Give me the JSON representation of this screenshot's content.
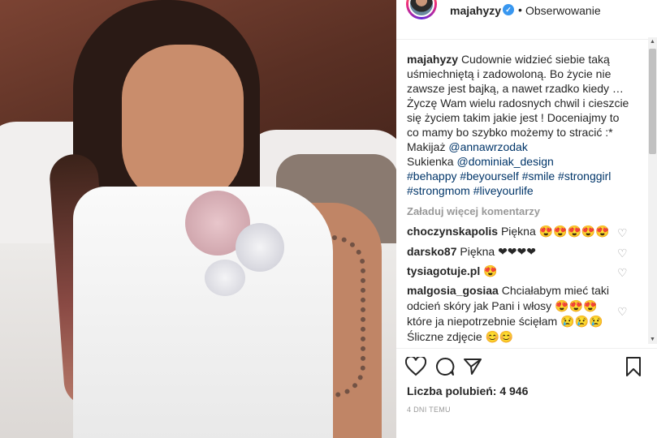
{
  "post": {
    "username": "majahyzy",
    "verified_mark": "✓",
    "separator": "•",
    "follow_label": "Obserwowanie"
  },
  "caption": {
    "username": "majahyzy",
    "text": "Cudownie widzieć siebie taką uśmiechniętą i zadowoloną. Bo życie nie zawsze jest bajką, a nawet rzadko kiedy … Życzę Wam wielu radosnych chwil i cieszcie się życiem takim jakie jest ! Doceniajmy to co mamy bo szybko możemy to stracić :*",
    "makeup_label": "Makijaż",
    "makeup_tag": "@annawrzodak",
    "dress_label": "Sukienka",
    "dress_tag": "@dominiak_design",
    "hashtags": [
      "#behappy",
      "#beyourself",
      "#smile",
      "#stronggirl",
      "#strongmom",
      "#liveyourlife"
    ]
  },
  "load_more_label": "Załaduj więcej komentarzy",
  "comments": [
    {
      "user": "choczynskapolis",
      "text": "Piękna 😍😍😍😍😍"
    },
    {
      "user": "darsko87",
      "text": "Piękna ❤❤❤❤"
    },
    {
      "user": "tysiagotuje.pl",
      "text": "😍"
    },
    {
      "user": "malgosia_gosiaa",
      "text": "Chciałabym mieć taki odcień skóry jak Pani i włosy 😍😍😍 które ja niepotrzebnie ścięłam 😢😢😢 Śliczne zdjęcie 😊😊"
    }
  ],
  "icons": {
    "heart": "heart-icon",
    "comment": "comment-icon",
    "share": "share-icon",
    "save": "bookmark-icon"
  },
  "likes_text": "Liczba polubień: 4 946",
  "timestamp": "4 DNI TEMU"
}
